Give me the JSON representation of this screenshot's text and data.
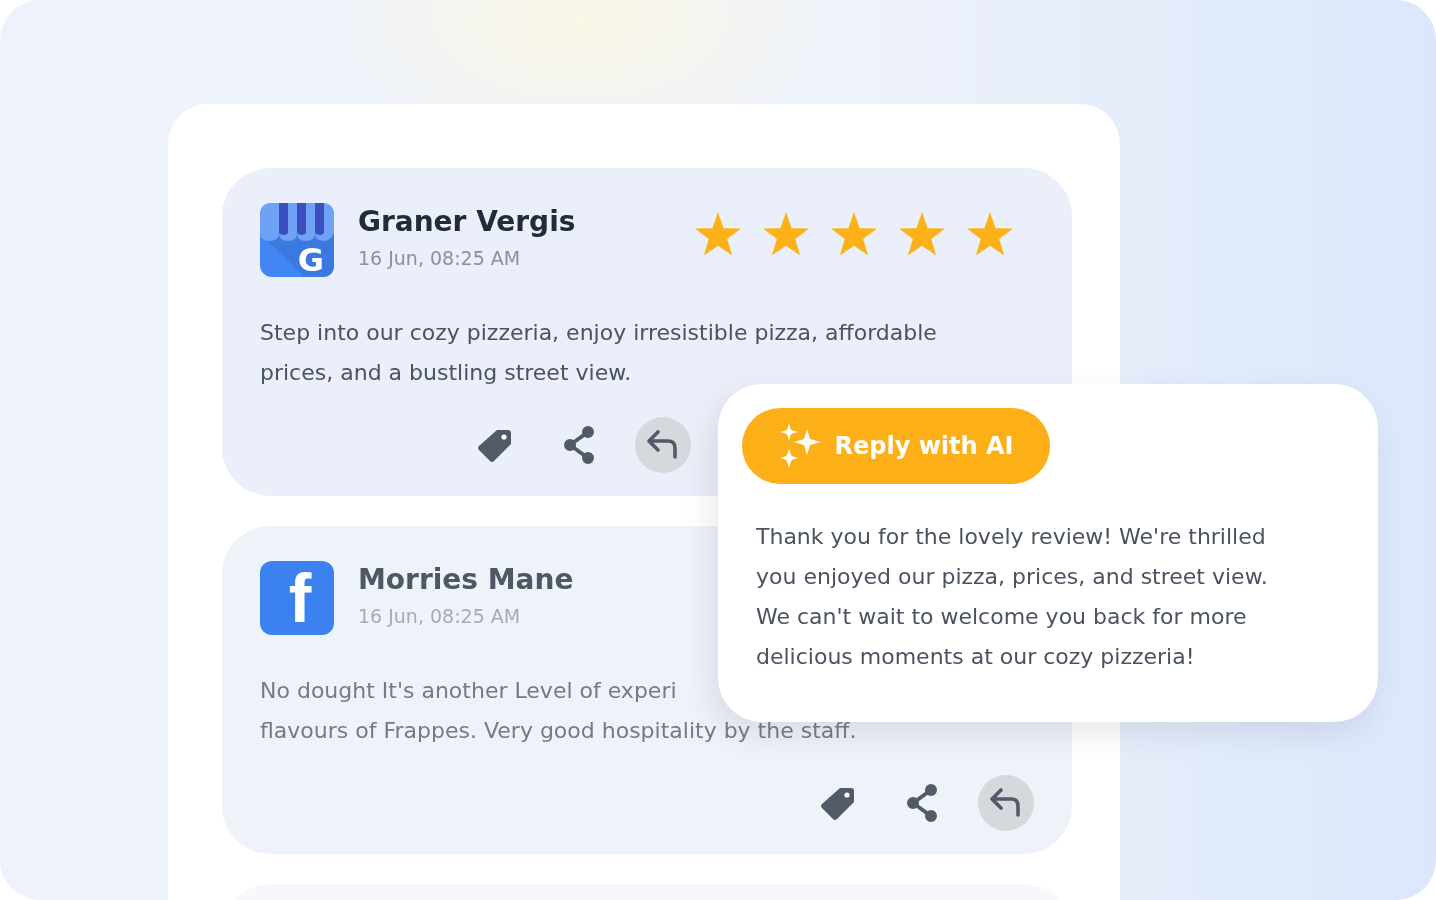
{
  "reviews": [
    {
      "kind": "google",
      "logo_text": "G",
      "name": "Graner Vergis",
      "date": "16 Jun, 08:25 AM",
      "stars": 5,
      "faded": false,
      "text_lines": [
        "Step into our cozy pizzeria, enjoy irresistible pizza, affordable",
        "prices, and a bustling street view."
      ]
    },
    {
      "kind": "facebook",
      "logo_text": "f",
      "name": "Morries Mane",
      "date": "16 Jun, 08:25 AM",
      "faded": true,
      "text_lines": [
        "No dought It's another Level of experi",
        "flavours of Frappes. Very good hospitality by the staff."
      ]
    }
  ],
  "ai_reply": {
    "button": "Reply with AI",
    "text_lines": [
      "Thank you for the lovely review! We're thrilled",
      "you enjoyed our pizza, prices, and street view.",
      "We can't wait to welcome you back for more",
      "delicious moments at our cozy pizzeria!"
    ]
  }
}
